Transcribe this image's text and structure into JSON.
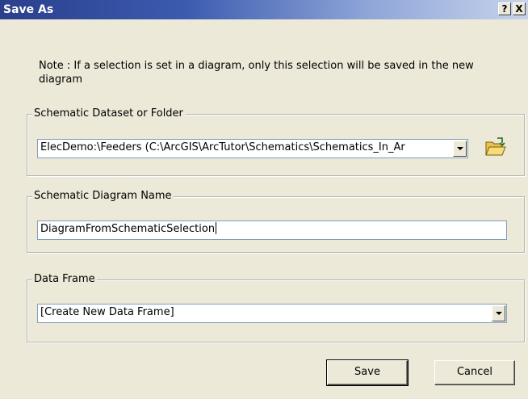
{
  "window": {
    "title": "Save As",
    "help_label": "?",
    "close_label": "X"
  },
  "note": "Note : If a selection is set in a diagram, only this selection will be saved in the new diagram",
  "dataset_group": {
    "legend": "Schematic Dataset or Folder",
    "value": "ElecDemo:\\Feeders (C:\\ArcGIS\\ArcTutor\\Schematics\\Schematics_In_Ar"
  },
  "name_group": {
    "legend": "Schematic Diagram Name",
    "value": "DiagramFromSchematicSelection"
  },
  "frame_group": {
    "legend": "Data Frame",
    "value": "[Create New Data Frame]"
  },
  "buttons": {
    "save": "Save",
    "cancel": "Cancel"
  },
  "icons": {
    "browse": "open-folder-icon",
    "dropdown": "chevron-down-icon"
  },
  "colors": {
    "titlebar_start": "#2b3f8c",
    "dialog_bg": "#ece9d8",
    "field_border": "#7f9db9"
  }
}
